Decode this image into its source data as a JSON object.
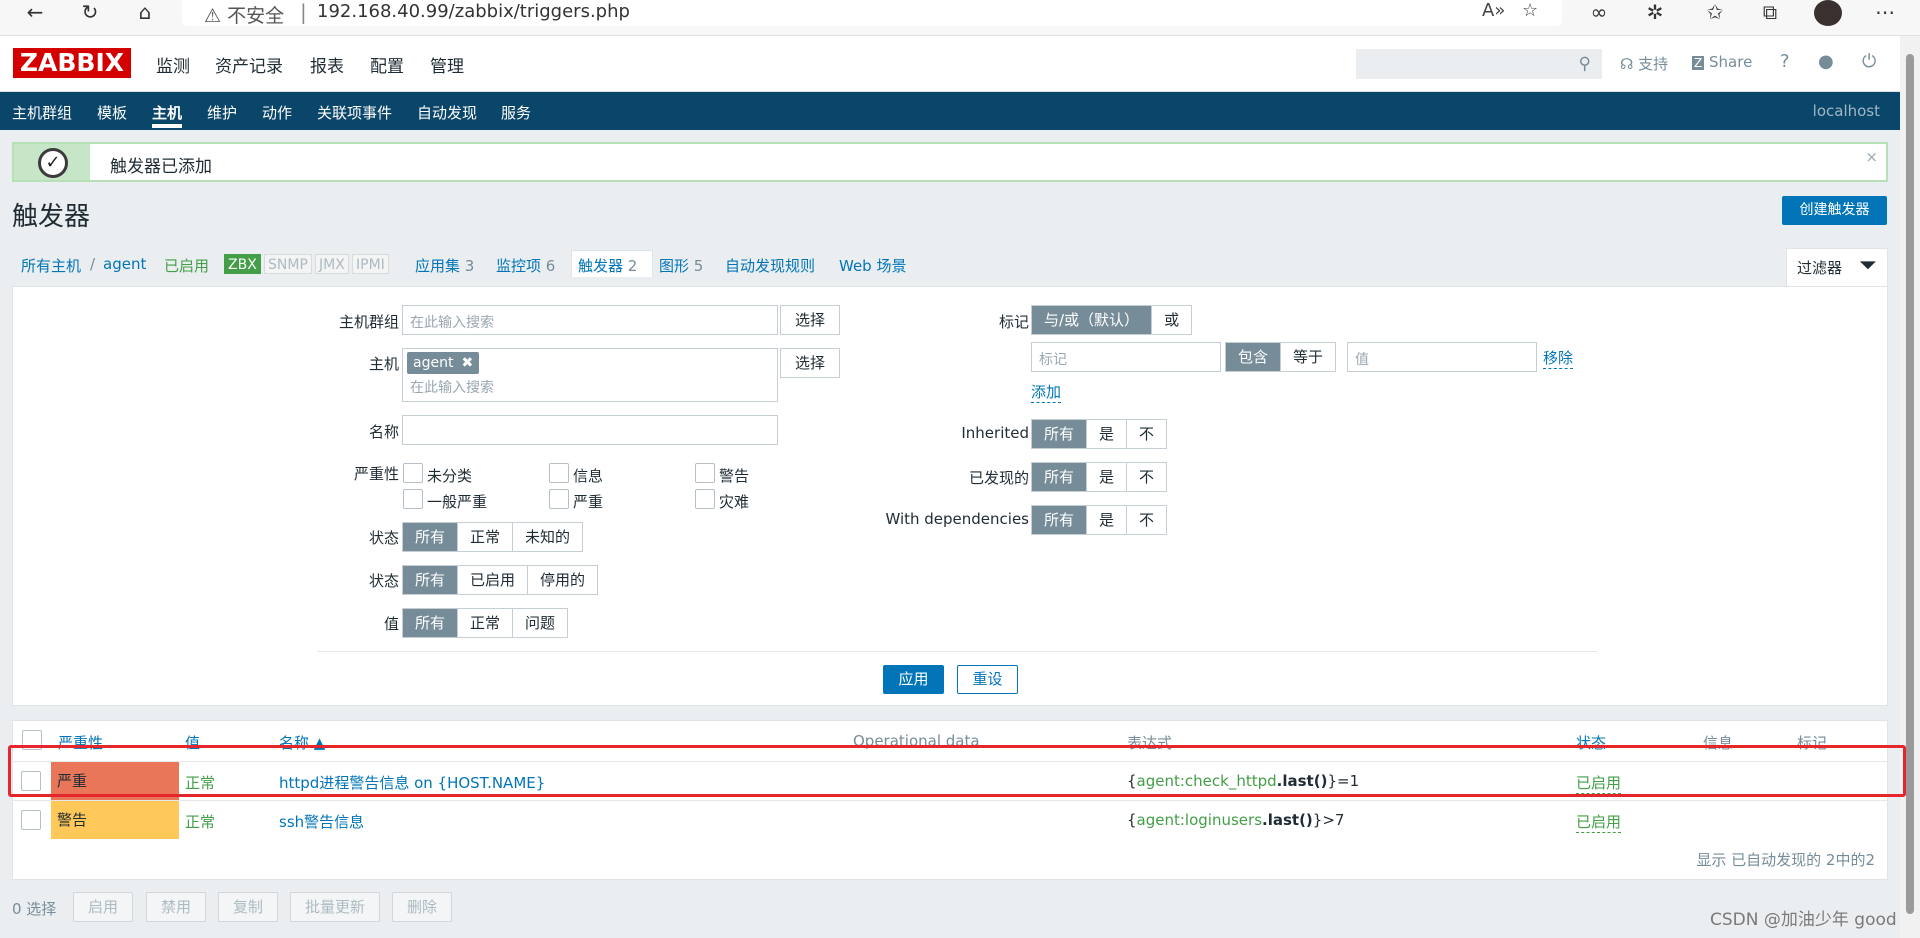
{
  "browser": {
    "security": "不安全",
    "url": "192.168.40.99/zabbix/triggers.php"
  },
  "header": {
    "logo": "ZABBIX",
    "main_nav": [
      "监测",
      "资产记录",
      "报表",
      "配置",
      "管理"
    ],
    "support": "支持",
    "share": "Share",
    "help": "?"
  },
  "subnav": {
    "items": [
      "主机群组",
      "模板",
      "主机",
      "维护",
      "动作",
      "关联项事件",
      "自动发现",
      "服务"
    ],
    "server": "localhost"
  },
  "message": {
    "text": "触发器已添加",
    "close": "×"
  },
  "page": {
    "title": "触发器",
    "create_button": "创建触发器"
  },
  "breadcrumb": {
    "all_hosts": "所有主机",
    "sep": "/",
    "host": "agent",
    "enabled": "已启用",
    "tags": [
      "ZBX",
      "SNMP",
      "JMX",
      "IPMI"
    ],
    "tabs": [
      {
        "label": "应用集",
        "count": "3"
      },
      {
        "label": "监控项",
        "count": "6"
      },
      {
        "label": "触发器",
        "count": "2"
      },
      {
        "label": "图形",
        "count": "5"
      },
      {
        "label": "自动发现规则",
        "count": ""
      },
      {
        "label": "Web 场景",
        "count": ""
      }
    ]
  },
  "filter": {
    "tab_label": "过滤器",
    "host_group_label": "主机群组",
    "host_group_placeholder": "在此输入搜索",
    "select_button": "选择",
    "host_label": "主机",
    "host_chip": "agent",
    "host_chip_remove": "✖",
    "host_placeholder": "在此输入搜索",
    "name_label": "名称",
    "severity_label": "严重性",
    "severities": [
      "未分类",
      "信息",
      "警告",
      "一般严重",
      "严重",
      "灾难"
    ],
    "state_label": "状态",
    "state_options": [
      "所有",
      "正常",
      "未知的"
    ],
    "status_label": "状态",
    "status_options": [
      "所有",
      "已启用",
      "停用的"
    ],
    "value_label": "值",
    "value_options": [
      "所有",
      "正常",
      "问题"
    ],
    "tags_label": "标记",
    "tags_mode": [
      "与/或（默认）",
      "或"
    ],
    "tag_placeholder": "标记",
    "tag_ops": [
      "包含",
      "等于"
    ],
    "value_placeholder": "值",
    "remove_link": "移除",
    "add_link": "添加",
    "inherited_label": "Inherited",
    "discovered_label": "已发现的",
    "dependencies_label": "With dependencies",
    "tri_options": [
      "所有",
      "是",
      "不"
    ],
    "apply": "应用",
    "reset": "重设"
  },
  "table": {
    "headers": [
      "严重性",
      "值",
      "名称 ▲",
      "Operational data",
      "表达式",
      "状态",
      "信息",
      "标记"
    ],
    "rows": [
      {
        "severity": "严重",
        "severity_color": "#e97659",
        "value": "正常",
        "name": "httpd进程警告信息 on {HOST.NAME}",
        "expr_open": "{",
        "expr_host_key": "agent:check_httpd",
        "expr_func": ".last()",
        "expr_close": "}=1",
        "status": "已启用"
      },
      {
        "severity": "警告",
        "severity_color": "#ffc859",
        "value": "正常",
        "name": "ssh警告信息",
        "expr_open": "{",
        "expr_host_key": "agent:loginusers",
        "expr_func": ".last()",
        "expr_close": "}>7",
        "status": "已启用"
      }
    ],
    "footer": "显示 已自动发现的 2中的2"
  },
  "bottom": {
    "selected": "0 选择",
    "buttons": [
      "启用",
      "禁用",
      "复制",
      "批量更新",
      "删除"
    ]
  },
  "watermark": "CSDN @加油少年 good"
}
